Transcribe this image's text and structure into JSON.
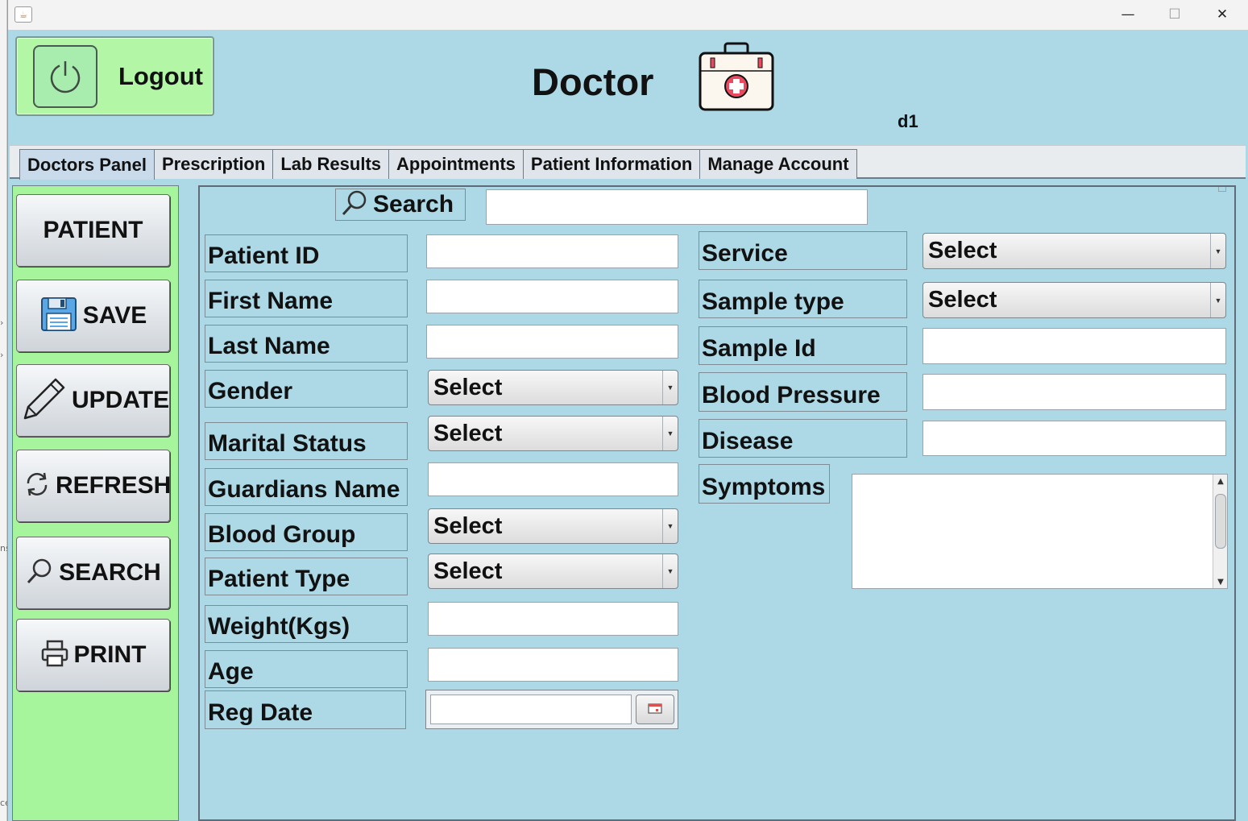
{
  "window": {
    "controls": {
      "minimize": "—",
      "maximize": "☐",
      "close": "✕"
    }
  },
  "header": {
    "logout_label": "Logout",
    "title": "Doctor",
    "user": "d1"
  },
  "tabs": [
    {
      "label": "Doctors Panel",
      "active": true
    },
    {
      "label": "Prescription",
      "active": false
    },
    {
      "label": "Lab Results",
      "active": false
    },
    {
      "label": "Appointments",
      "active": false
    },
    {
      "label": "Patient Information",
      "active": false
    },
    {
      "label": "Manage Account",
      "active": false
    }
  ],
  "sidebar": {
    "buttons": [
      {
        "label": "PATIENT",
        "icon": "none"
      },
      {
        "label": "SAVE",
        "icon": "floppy-disk-icon"
      },
      {
        "label": "UPDATE",
        "icon": "pencil-icon"
      },
      {
        "label": "REFRESH",
        "icon": "refresh-icon"
      },
      {
        "label": "SEARCH",
        "icon": "search-icon"
      },
      {
        "label": "PRINT",
        "icon": "printer-icon"
      }
    ]
  },
  "search": {
    "label": "Search",
    "value": ""
  },
  "form_left": {
    "patient_id": {
      "label": "Patient ID",
      "value": ""
    },
    "first_name": {
      "label": "First Name",
      "value": ""
    },
    "last_name": {
      "label": "Last Name",
      "value": ""
    },
    "gender": {
      "label": "Gender",
      "selected": "Select"
    },
    "marital_status": {
      "label": "Marital Status",
      "selected": "Select"
    },
    "guardians_name": {
      "label": "Guardians Name",
      "value": ""
    },
    "blood_group": {
      "label": "Blood Group",
      "selected": "Select"
    },
    "patient_type": {
      "label": "Patient Type",
      "selected": "Select"
    },
    "weight": {
      "label": "Weight(Kgs)",
      "value": ""
    },
    "age": {
      "label": "Age",
      "value": ""
    },
    "reg_date": {
      "label": "Reg Date",
      "value": ""
    }
  },
  "form_right": {
    "service": {
      "label": "Service",
      "selected": "Select"
    },
    "sample_type": {
      "label": "Sample type",
      "selected": "Select"
    },
    "sample_id": {
      "label": "Sample Id",
      "value": ""
    },
    "blood_pressure": {
      "label": "Blood Pressure",
      "value": ""
    },
    "disease": {
      "label": "Disease",
      "value": ""
    },
    "symptoms": {
      "label": "Symptoms",
      "value": ""
    }
  },
  "colors": {
    "background": "#add8e6",
    "sidebar": "#a6f59c",
    "logout_button": "#b3f7a6"
  }
}
